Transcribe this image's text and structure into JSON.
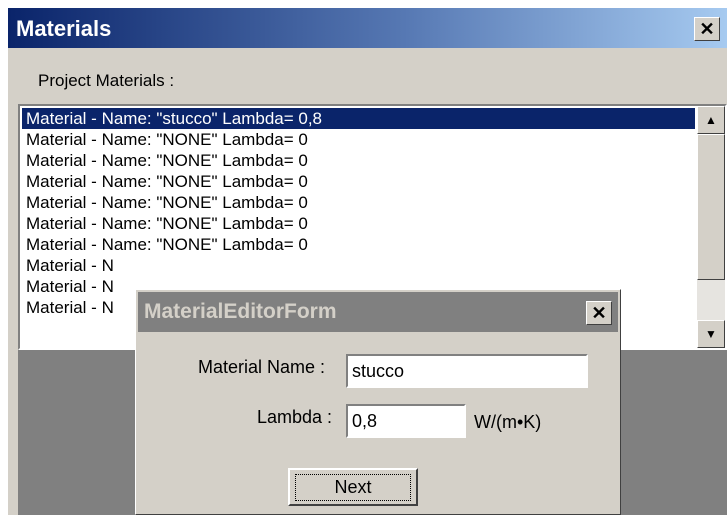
{
  "window": {
    "title": "Materials",
    "close_glyph": "✕"
  },
  "section_label": "Project Materials :",
  "materials": [
    "Material - Name: \"stucco\" Lambda= 0,8",
    "Material - Name: \"NONE\" Lambda= 0",
    "Material - Name: \"NONE\" Lambda= 0",
    "Material - Name: \"NONE\" Lambda= 0",
    "Material - Name: \"NONE\" Lambda= 0",
    "Material - Name: \"NONE\" Lambda= 0",
    "Material - Name: \"NONE\" Lambda= 0",
    "Material - N",
    "Material - N",
    "Material - N"
  ],
  "selected_index": 0,
  "scroll": {
    "up": "▲",
    "down": "▼"
  },
  "dialog": {
    "title": "MaterialEditorForm",
    "close_glyph": "✕",
    "name_label": "Material Name :",
    "name_value": "stucco",
    "lambda_label": "Lambda :",
    "lambda_value": "0,8",
    "unit": "W/(m•K)",
    "next_label": "Next"
  },
  "colors": {
    "selection": "#0a246a",
    "face": "#d4d0c8",
    "inactive_title": "#808080"
  }
}
